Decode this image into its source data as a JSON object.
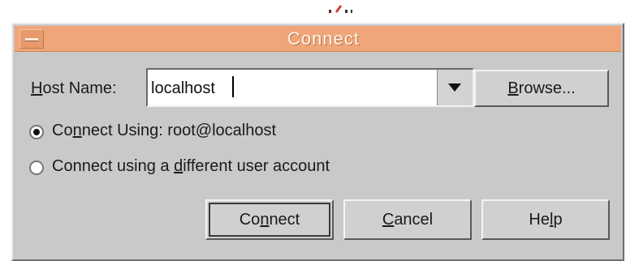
{
  "window": {
    "title": "Connect"
  },
  "host": {
    "label_pre": "",
    "label_mnemonic": "H",
    "label_post": "ost Name:",
    "value": "localhost"
  },
  "browse_button": {
    "mnemonic": "B",
    "post": "rowse..."
  },
  "radio_options": [
    {
      "pre": "Co",
      "mnemonic": "n",
      "post": "nect Using: root@localhost",
      "selected": true
    },
    {
      "pre": "Connect using a ",
      "mnemonic": "d",
      "post": "ifferent user account",
      "selected": false
    }
  ],
  "buttons": {
    "connect": {
      "pre": "Co",
      "mnemonic": "n",
      "post": "nect"
    },
    "cancel": {
      "pre": "",
      "mnemonic": "C",
      "post": "ancel"
    },
    "help": {
      "pre": "He",
      "mnemonic": "l",
      "post": "p"
    }
  },
  "icons": {
    "system_menu": "window-menu-icon",
    "combo_dropdown": "chevron-down-icon",
    "radio_selected": "radio-selected-icon",
    "radio_unselected": "radio-unselected-icon"
  },
  "colors": {
    "titlebar": "#f0a679",
    "dialog_bg": "#c9c9c9",
    "title_text": "#fff6ef"
  }
}
